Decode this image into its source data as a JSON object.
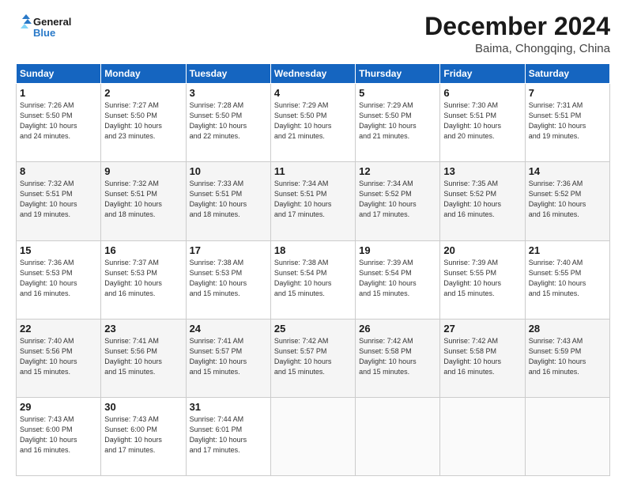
{
  "header": {
    "logo_line1": "General",
    "logo_line2": "Blue",
    "title": "December 2024",
    "subtitle": "Baima, Chongqing, China"
  },
  "weekdays": [
    "Sunday",
    "Monday",
    "Tuesday",
    "Wednesday",
    "Thursday",
    "Friday",
    "Saturday"
  ],
  "weeks": [
    [
      {
        "day": "1",
        "text": "Sunrise: 7:26 AM\nSunset: 5:50 PM\nDaylight: 10 hours\nand 24 minutes."
      },
      {
        "day": "2",
        "text": "Sunrise: 7:27 AM\nSunset: 5:50 PM\nDaylight: 10 hours\nand 23 minutes."
      },
      {
        "day": "3",
        "text": "Sunrise: 7:28 AM\nSunset: 5:50 PM\nDaylight: 10 hours\nand 22 minutes."
      },
      {
        "day": "4",
        "text": "Sunrise: 7:29 AM\nSunset: 5:50 PM\nDaylight: 10 hours\nand 21 minutes."
      },
      {
        "day": "5",
        "text": "Sunrise: 7:29 AM\nSunset: 5:50 PM\nDaylight: 10 hours\nand 21 minutes."
      },
      {
        "day": "6",
        "text": "Sunrise: 7:30 AM\nSunset: 5:51 PM\nDaylight: 10 hours\nand 20 minutes."
      },
      {
        "day": "7",
        "text": "Sunrise: 7:31 AM\nSunset: 5:51 PM\nDaylight: 10 hours\nand 19 minutes."
      }
    ],
    [
      {
        "day": "8",
        "text": "Sunrise: 7:32 AM\nSunset: 5:51 PM\nDaylight: 10 hours\nand 19 minutes."
      },
      {
        "day": "9",
        "text": "Sunrise: 7:32 AM\nSunset: 5:51 PM\nDaylight: 10 hours\nand 18 minutes."
      },
      {
        "day": "10",
        "text": "Sunrise: 7:33 AM\nSunset: 5:51 PM\nDaylight: 10 hours\nand 18 minutes."
      },
      {
        "day": "11",
        "text": "Sunrise: 7:34 AM\nSunset: 5:51 PM\nDaylight: 10 hours\nand 17 minutes."
      },
      {
        "day": "12",
        "text": "Sunrise: 7:34 AM\nSunset: 5:52 PM\nDaylight: 10 hours\nand 17 minutes."
      },
      {
        "day": "13",
        "text": "Sunrise: 7:35 AM\nSunset: 5:52 PM\nDaylight: 10 hours\nand 16 minutes."
      },
      {
        "day": "14",
        "text": "Sunrise: 7:36 AM\nSunset: 5:52 PM\nDaylight: 10 hours\nand 16 minutes."
      }
    ],
    [
      {
        "day": "15",
        "text": "Sunrise: 7:36 AM\nSunset: 5:53 PM\nDaylight: 10 hours\nand 16 minutes."
      },
      {
        "day": "16",
        "text": "Sunrise: 7:37 AM\nSunset: 5:53 PM\nDaylight: 10 hours\nand 16 minutes."
      },
      {
        "day": "17",
        "text": "Sunrise: 7:38 AM\nSunset: 5:53 PM\nDaylight: 10 hours\nand 15 minutes."
      },
      {
        "day": "18",
        "text": "Sunrise: 7:38 AM\nSunset: 5:54 PM\nDaylight: 10 hours\nand 15 minutes."
      },
      {
        "day": "19",
        "text": "Sunrise: 7:39 AM\nSunset: 5:54 PM\nDaylight: 10 hours\nand 15 minutes."
      },
      {
        "day": "20",
        "text": "Sunrise: 7:39 AM\nSunset: 5:55 PM\nDaylight: 10 hours\nand 15 minutes."
      },
      {
        "day": "21",
        "text": "Sunrise: 7:40 AM\nSunset: 5:55 PM\nDaylight: 10 hours\nand 15 minutes."
      }
    ],
    [
      {
        "day": "22",
        "text": "Sunrise: 7:40 AM\nSunset: 5:56 PM\nDaylight: 10 hours\nand 15 minutes."
      },
      {
        "day": "23",
        "text": "Sunrise: 7:41 AM\nSunset: 5:56 PM\nDaylight: 10 hours\nand 15 minutes."
      },
      {
        "day": "24",
        "text": "Sunrise: 7:41 AM\nSunset: 5:57 PM\nDaylight: 10 hours\nand 15 minutes."
      },
      {
        "day": "25",
        "text": "Sunrise: 7:42 AM\nSunset: 5:57 PM\nDaylight: 10 hours\nand 15 minutes."
      },
      {
        "day": "26",
        "text": "Sunrise: 7:42 AM\nSunset: 5:58 PM\nDaylight: 10 hours\nand 15 minutes."
      },
      {
        "day": "27",
        "text": "Sunrise: 7:42 AM\nSunset: 5:58 PM\nDaylight: 10 hours\nand 16 minutes."
      },
      {
        "day": "28",
        "text": "Sunrise: 7:43 AM\nSunset: 5:59 PM\nDaylight: 10 hours\nand 16 minutes."
      }
    ],
    [
      {
        "day": "29",
        "text": "Sunrise: 7:43 AM\nSunset: 6:00 PM\nDaylight: 10 hours\nand 16 minutes."
      },
      {
        "day": "30",
        "text": "Sunrise: 7:43 AM\nSunset: 6:00 PM\nDaylight: 10 hours\nand 17 minutes."
      },
      {
        "day": "31",
        "text": "Sunrise: 7:44 AM\nSunset: 6:01 PM\nDaylight: 10 hours\nand 17 minutes."
      },
      {
        "day": "",
        "text": ""
      },
      {
        "day": "",
        "text": ""
      },
      {
        "day": "",
        "text": ""
      },
      {
        "day": "",
        "text": ""
      }
    ]
  ]
}
